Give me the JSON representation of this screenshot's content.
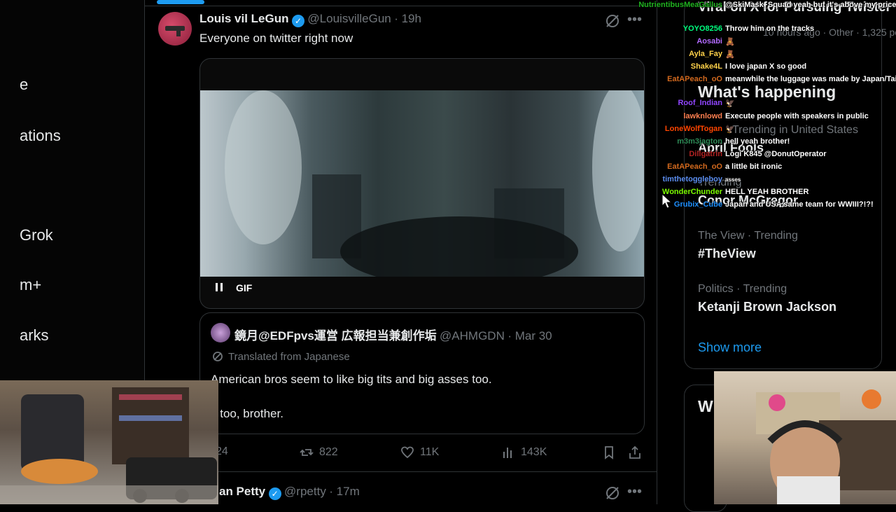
{
  "left_nav": {
    "items": [
      {
        "label": "e",
        "top": 0
      },
      {
        "label": "ations"
      },
      {
        "label": "Grok"
      },
      {
        "label": "m+"
      },
      {
        "label": "arks"
      }
    ]
  },
  "tweet1": {
    "name": "Louis vil LeGun",
    "handle": "@LouisvilleGun",
    "time": "· 19h",
    "text": "Everyone on twitter right now",
    "gif_label": "GIF"
  },
  "quote": {
    "name": "鏡月@EDFpvs運営 広報担当兼創作垢",
    "handle": "@AHMGDN",
    "time": "· Mar 30",
    "translated": "Translated from Japanese",
    "line1": "American bros seem to like big tits and big asses too.",
    "line2": "s too, brother."
  },
  "actions": {
    "replies": "24",
    "reposts": "822",
    "likes": "11K",
    "views": "143K"
  },
  "tweet2": {
    "name": "an Petty",
    "handle": "@rpetty",
    "time": "· 17m"
  },
  "right": {
    "partial_top": "Viral on X for Pursuing Twister",
    "partial_top_meta": "10 hours ago · Other · 1,325 pos",
    "heading": "What's happening",
    "t1_meta": "Trending in United States",
    "t1_name": "April Fools",
    "t2_meta": "Trending",
    "t2_name": "Conor McGregor",
    "t3_meta": "The View · Trending",
    "t3_name": "#TheView",
    "t4_meta": "Politics · Trending",
    "t4_name": "Ketanji Brown Jackson",
    "show_more": "Show more",
    "second_card_heading": "W"
  },
  "chat": [
    {
      "user": "NutrientibusMeaGallus",
      "color": "#1fb31f",
      "msg": "@SkiMask_Squad yeah but it's above my price range"
    },
    {
      "user": "YOYO8256",
      "color": "#00ff7f",
      "msg": "Throw him on the tracks"
    },
    {
      "user": "Aosabi",
      "color": "#b26bff",
      "msg": "🧸"
    },
    {
      "user": "Ayla_Fay",
      "color": "#ffd24a",
      "msg": "🧸"
    },
    {
      "user": "Shake4L",
      "color": "#ffd24a",
      "msg": "I love japan X so good"
    },
    {
      "user": "EatAPeach_oO",
      "color": "#d2691e",
      "msg": "meanwhile the luggage was made by Japan/Taiwan"
    },
    {
      "user": "Roof_Indian",
      "color": "#9146ff",
      "msg": "🦅"
    },
    {
      "user": "lawknlowd",
      "color": "#ff7f50",
      "msg": "Execute people with speakers in public"
    },
    {
      "user": "LoneWolfTogan",
      "color": "#ff4500",
      "msg": "🦅"
    },
    {
      "user": "m3m3jagton",
      "color": "#2e8b57",
      "msg": "hell yeah brother!"
    },
    {
      "user": "Dillgatrin",
      "color": "#b22222",
      "msg": "Logi K845 @DonutOperator"
    },
    {
      "user": "EatAPeach_oO",
      "color": "#d2691e",
      "msg": "a little bit ironic"
    },
    {
      "user": "timthetoggleboy",
      "color": "#5b8def",
      "msg": "asses"
    },
    {
      "user": "WonderChunder",
      "color": "#7cfc00",
      "msg": "HELL YEAH BROTHER"
    },
    {
      "user": "Grubix_Cube",
      "color": "#1e90ff",
      "msg": "Japan and USA same team for WWIII?!?!"
    }
  ],
  "colors": {
    "accent": "#1d9bf0",
    "border": "#2f3336",
    "muted": "#71767b",
    "text": "#e7e9ea"
  }
}
